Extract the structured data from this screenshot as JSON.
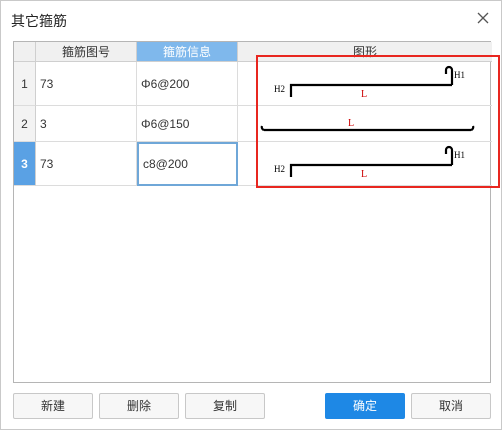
{
  "dialog": {
    "title": "其它箍筋"
  },
  "table": {
    "columns": [
      "箍筋图号",
      "箍筋信息",
      "图形"
    ],
    "selected_column": 1,
    "rows": [
      {
        "num": "1",
        "code": "73",
        "info": "Φ6@200",
        "shape": "73"
      },
      {
        "num": "2",
        "code": "3",
        "info": "Φ6@150",
        "shape": "3"
      },
      {
        "num": "3",
        "code": "73",
        "info": "c8@200",
        "shape": "73"
      }
    ],
    "selected_row": 2
  },
  "shape_labels": {
    "h1": "H1",
    "h2": "H2",
    "l": "L"
  },
  "buttons": {
    "new": "新建",
    "delete": "删除",
    "copy": "复制",
    "ok": "确定",
    "cancel": "取消"
  },
  "colors": {
    "accent": "#1e88e5",
    "header_selected": "#7fb8ec",
    "row_selected": "#5aa1e4",
    "highlight_box": "#e8261f",
    "label_red": "#cc0000"
  }
}
